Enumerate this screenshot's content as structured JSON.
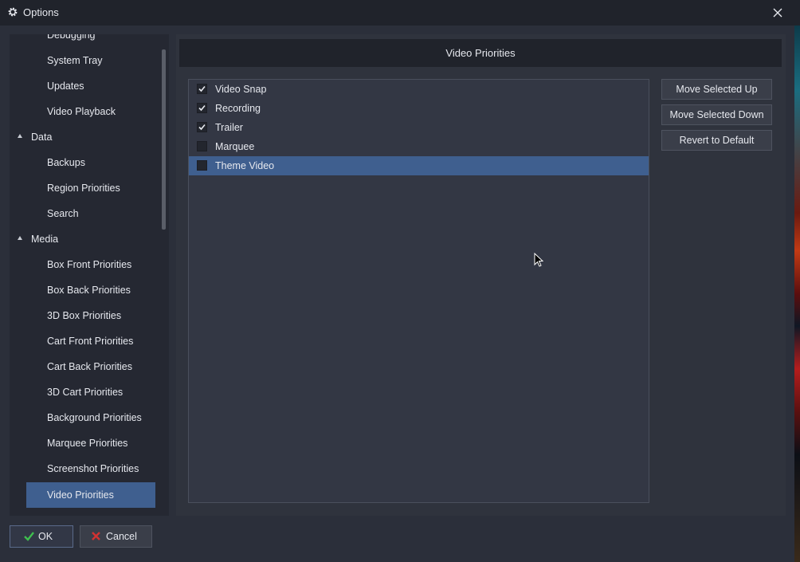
{
  "window": {
    "title": "Options"
  },
  "sidebar": {
    "items": [
      {
        "label": "Debugging",
        "type": "child"
      },
      {
        "label": "System Tray",
        "type": "child"
      },
      {
        "label": "Updates",
        "type": "child"
      },
      {
        "label": "Video Playback",
        "type": "child"
      },
      {
        "label": "Data",
        "type": "group",
        "expanded": true
      },
      {
        "label": "Backups",
        "type": "child"
      },
      {
        "label": "Region Priorities",
        "type": "child"
      },
      {
        "label": "Search",
        "type": "child"
      },
      {
        "label": "Media",
        "type": "group",
        "expanded": true
      },
      {
        "label": "Box Front Priorities",
        "type": "child"
      },
      {
        "label": "Box Back Priorities",
        "type": "child"
      },
      {
        "label": "3D Box Priorities",
        "type": "child"
      },
      {
        "label": "Cart Front Priorities",
        "type": "child"
      },
      {
        "label": "Cart Back Priorities",
        "type": "child"
      },
      {
        "label": "3D Cart Priorities",
        "type": "child"
      },
      {
        "label": "Background Priorities",
        "type": "child"
      },
      {
        "label": "Marquee Priorities",
        "type": "child"
      },
      {
        "label": "Screenshot Priorities",
        "type": "child"
      },
      {
        "label": "Video Priorities",
        "type": "child",
        "selected": true
      }
    ]
  },
  "panel": {
    "header": "Video Priorities",
    "list": [
      {
        "label": "Video Snap",
        "checked": true,
        "selected": false
      },
      {
        "label": "Recording",
        "checked": true,
        "selected": false
      },
      {
        "label": "Trailer",
        "checked": true,
        "selected": false
      },
      {
        "label": "Marquee",
        "checked": false,
        "selected": false
      },
      {
        "label": "Theme Video",
        "checked": false,
        "selected": true
      }
    ],
    "buttons": {
      "move_up": "Move Selected Up",
      "move_down": "Move Selected Down",
      "revert": "Revert to Default"
    }
  },
  "footer": {
    "ok_label": "OK",
    "cancel_label": "Cancel"
  },
  "colors": {
    "accent": "#3f5f8f",
    "ok_icon": "#3fbf4f",
    "cancel_icon": "#d23232"
  },
  "icons": {
    "window": "gear-icon",
    "close": "close-icon",
    "ok": "checkmark-icon",
    "cancel": "x-icon",
    "group_expand": "triangle-icon"
  }
}
